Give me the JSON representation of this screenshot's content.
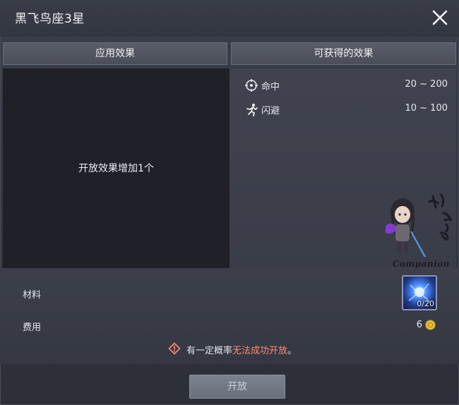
{
  "dialog": {
    "title": "黑飞鸟座3星"
  },
  "tabs": {
    "applied": "应用效果",
    "obtainable": "可获得的效果"
  },
  "applied_effect": {
    "text": "开放效果增加1个"
  },
  "obtainable_effects": [
    {
      "icon": "crosshair-icon",
      "name": "命中",
      "range": "20 ~ 200"
    },
    {
      "icon": "dodge-runner-icon",
      "name": "闪避",
      "range": "10 ~ 100"
    }
  ],
  "watermark": {
    "label": "Companion",
    "calligraphy": "攻略组"
  },
  "requirements": {
    "material_label": "材料",
    "material_count": "0/20",
    "cost_label": "费用",
    "cost_value": "6",
    "cost_icon": "gold-coin-icon"
  },
  "warning": {
    "prefix": "有一定概率",
    "highlight": "无法成功开放",
    "suffix": "。",
    "highlight_color": "#ff8a73"
  },
  "actions": {
    "open_label": "开放"
  }
}
